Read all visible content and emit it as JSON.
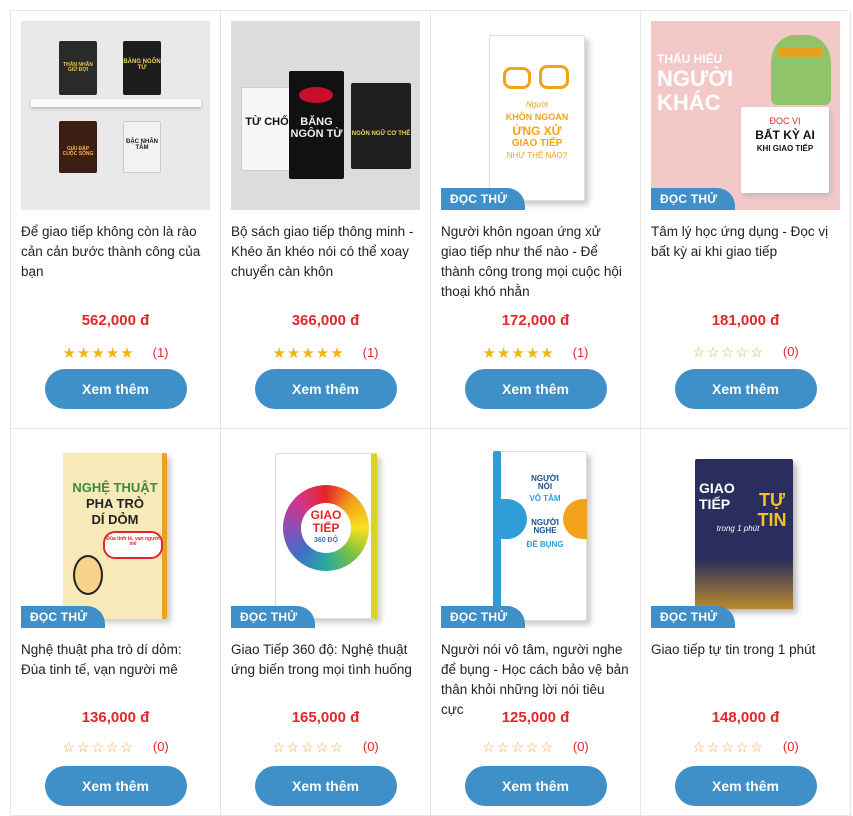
{
  "products": [
    {
      "title": "Để giao tiếp không còn là rào cản cản bước thành công của bạn",
      "price": "562,000 đ",
      "stars": "★★★★★",
      "rating_count": "(1)",
      "button": "Xem thêm",
      "badge": ""
    },
    {
      "title": "Bộ sách giao tiếp thông minh - Khéo ăn khéo nói có thể xoay chuyển càn khôn",
      "price": "366,000 đ",
      "stars": "★★★★★",
      "rating_count": "(1)",
      "button": "Xem thêm",
      "badge": ""
    },
    {
      "title": "Người khôn ngoan ứng xử giao tiếp như thế nào - Để thành công trong mọi cuộc hội thoại khó nhằn",
      "price": "172,000 đ",
      "stars": "★★★★★",
      "rating_count": "(1)",
      "button": "Xem thêm",
      "badge": "ĐỌC THỬ"
    },
    {
      "title": "Tâm lý học ứng dụng - Đọc vị bất kỳ ai khi giao tiếp",
      "price": "181,000 đ",
      "stars": "☆☆☆☆☆",
      "rating_count": "(0)",
      "button": "Xem thêm",
      "badge": "ĐỌC THỬ"
    },
    {
      "title": "Nghệ thuật pha trò dí dỏm: Đùa tinh tế, vạn người mê",
      "price": "136,000 đ",
      "stars": "☆☆☆☆☆",
      "rating_count": "(0)",
      "button": "Xem thêm",
      "badge": "ĐỌC THỬ"
    },
    {
      "title": "Giao Tiếp 360 độ: Nghệ thuật ứng biến trong mọi tình huống",
      "price": "165,000 đ",
      "stars": "☆☆☆☆☆",
      "rating_count": "(0)",
      "button": "Xem thêm",
      "badge": "ĐỌC THỬ"
    },
    {
      "title": "Người nói vô tâm, người nghe để bụng - Học cách bảo vệ bản thân khỏi những lời nói tiêu cực",
      "price": "125,000 đ",
      "stars": "☆☆☆☆☆",
      "rating_count": "(0)",
      "button": "Xem thêm",
      "badge": "ĐỌC THỬ"
    },
    {
      "title": "Giao tiếp tự tin trong 1 phút",
      "price": "148,000 đ",
      "stars": "☆☆☆☆☆",
      "rating_count": "(0)",
      "button": "Xem thêm",
      "badge": "ĐỌC THỬ"
    }
  ],
  "cover_text": {
    "c1_a": "THẦN NHÃN GIỮ ĐỢI",
    "c1_b": "BĂNG NGÔN TỪ",
    "c1_c": "GIẢI ĐÁP CUỘC SỐNG",
    "c1_d": "ĐẶC NHÂN TÂM",
    "c2_a": "TỪ CHỐI",
    "c2_b": "BĂNG NGÔN TỪ",
    "c2_c": "NGÔN NGỮ CƠ THỂ",
    "c3_a": "Người",
    "c3_b": "KHÔN NGOAN",
    "c3_c": "ỨNG XỬ",
    "c3_d": "GIAO TIẾP",
    "c3_e": "NHƯ THẾ NÀO?",
    "c4_a": "THẤU HIỂU",
    "c4_b": "NGƯỜI",
    "c4_c": "KHÁC",
    "c4_d": "ĐỌC VỊ",
    "c4_e": "BẤT KỲ AI",
    "c4_f": "KHI GIAO TIẾP",
    "c5_a": "NGHỆ THUẬT",
    "c5_b": "PHA TRÒ",
    "c5_c": "DÍ DỎM",
    "c5_d": "Đùa tinh tế, vạn người mê",
    "c6_a": "GIAO",
    "c6_b": "TIẾP",
    "c6_c": "360 ĐỘ",
    "c7_a": "NGƯỜI NÓI",
    "c7_b": "VÔ TÂM",
    "c7_c": "NGƯỜI NGHE",
    "c7_d": "ĐỂ BỤNG",
    "c8_a": "GIAO",
    "c8_b": "TIẾP",
    "c8_c": "TỰ",
    "c8_d": "TIN",
    "c8_e": "trong 1 phút"
  },
  "colors": {
    "accent": "#3f8fc9",
    "price": "#e3262a",
    "star": "#f5b40d"
  }
}
